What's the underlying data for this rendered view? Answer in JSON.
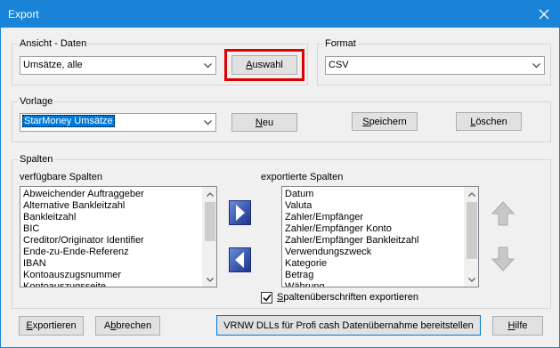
{
  "window": {
    "title": "Export"
  },
  "ansicht": {
    "group_label": "Ansicht - Daten",
    "combo_value": "Umsätze, alle",
    "auswahl_pre": "",
    "auswahl_u": "A",
    "auswahl_post": "uswahl"
  },
  "format": {
    "group_label": "Format",
    "combo_value": "CSV"
  },
  "vorlage": {
    "group_label": "Vorlage",
    "combo_value": "StarMoney Umsätze",
    "neu_u": "N",
    "neu_post": "eu",
    "speichern_u": "S",
    "speichern_post": "peichern",
    "loeschen_u": "L",
    "loeschen_post": "öschen"
  },
  "spalten": {
    "group_label": "Spalten",
    "available_label": "verfügbare Spalten",
    "exported_label": "exportierte Spalten",
    "available": [
      "Abweichender Auftraggeber",
      "Alternative Bankleitzahl",
      "Bankleitzahl",
      "BIC",
      "Creditor/Originator Identifier",
      "Ende-zu-Ende-Referenz",
      "IBAN",
      "Kontoauszugsnummer",
      "Kontoauszugsseite"
    ],
    "exported": [
      "Datum",
      "Valuta",
      "Zahler/Empfänger",
      "Zahler/Empfänger Konto",
      "Zahler/Empfänger Bankleitzahl",
      "Verwendungszweck",
      "Kategorie",
      "Betrag",
      "Währung"
    ],
    "header_checkbox_u": "S",
    "header_checkbox_post": "paltenüberschriften exportieren",
    "header_checkbox_checked": true
  },
  "footer": {
    "exportieren_u": "E",
    "exportieren_post": "xportieren",
    "abbrechen_pre": "A",
    "abbrechen_u": "b",
    "abbrechen_post": "brechen",
    "vrnw_label": "VRNW DLLs für Profi cash Datenübernahme bereitstellen",
    "hilfe_u": "H",
    "hilfe_post": "ilfe"
  },
  "colors": {
    "titlebar": "#1883d7",
    "highlight": "#e00000",
    "selection": "#0078d7"
  }
}
